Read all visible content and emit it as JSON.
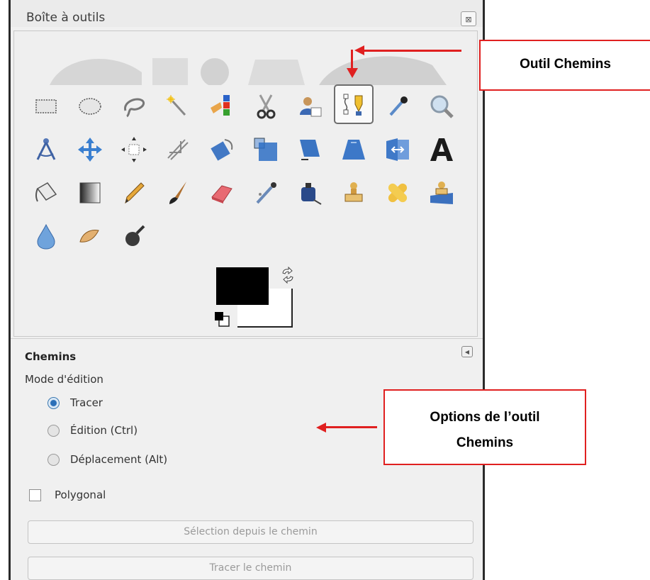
{
  "window": {
    "title": "Boîte à outils",
    "close_glyph": "⊠"
  },
  "tools": [
    {
      "name": "rect-select-icon"
    },
    {
      "name": "ellipse-select-icon"
    },
    {
      "name": "lasso-select-icon"
    },
    {
      "name": "fuzzy-select-icon"
    },
    {
      "name": "color-select-icon"
    },
    {
      "name": "scissors-select-icon"
    },
    {
      "name": "foreground-select-icon"
    },
    {
      "name": "paths-icon"
    },
    {
      "name": "color-picker-icon"
    },
    {
      "name": "zoom-icon"
    },
    {
      "name": "measure-icon"
    },
    {
      "name": "move-icon"
    },
    {
      "name": "align-icon"
    },
    {
      "name": "crop-icon"
    },
    {
      "name": "rotate-icon"
    },
    {
      "name": "scale-icon"
    },
    {
      "name": "shear-icon"
    },
    {
      "name": "perspective-icon"
    },
    {
      "name": "flip-icon"
    },
    {
      "name": "text-icon"
    },
    {
      "name": "bucket-fill-icon"
    },
    {
      "name": "blend-icon"
    },
    {
      "name": "pencil-icon"
    },
    {
      "name": "paintbrush-icon"
    },
    {
      "name": "eraser-icon"
    },
    {
      "name": "airbrush-icon"
    },
    {
      "name": "ink-icon"
    },
    {
      "name": "clone-icon"
    },
    {
      "name": "heal-icon"
    },
    {
      "name": "perspective-clone-icon"
    },
    {
      "name": "blur-sharpen-icon"
    },
    {
      "name": "smudge-icon"
    },
    {
      "name": "dodge-burn-icon"
    }
  ],
  "colors": {
    "foreground": "#000000",
    "background": "#ffffff",
    "callout_border": "#e02020"
  },
  "tool_options": {
    "title": "Chemins",
    "mode_label": "Mode d'édition",
    "modes": [
      {
        "label": "Tracer",
        "selected": true
      },
      {
        "label": "Édition (Ctrl)",
        "selected": false
      },
      {
        "label": "Déplacement (Alt)",
        "selected": false
      }
    ],
    "polygonal_label": "Polygonal",
    "polygonal_checked": false,
    "selection_button": "Sélection depuis le chemin",
    "stroke_button": "Tracer le chemin"
  },
  "annotations": {
    "tool_callout": "Outil  Chemins",
    "options_callout_line1": "Options de l’outil",
    "options_callout_line2": "Chemins"
  }
}
